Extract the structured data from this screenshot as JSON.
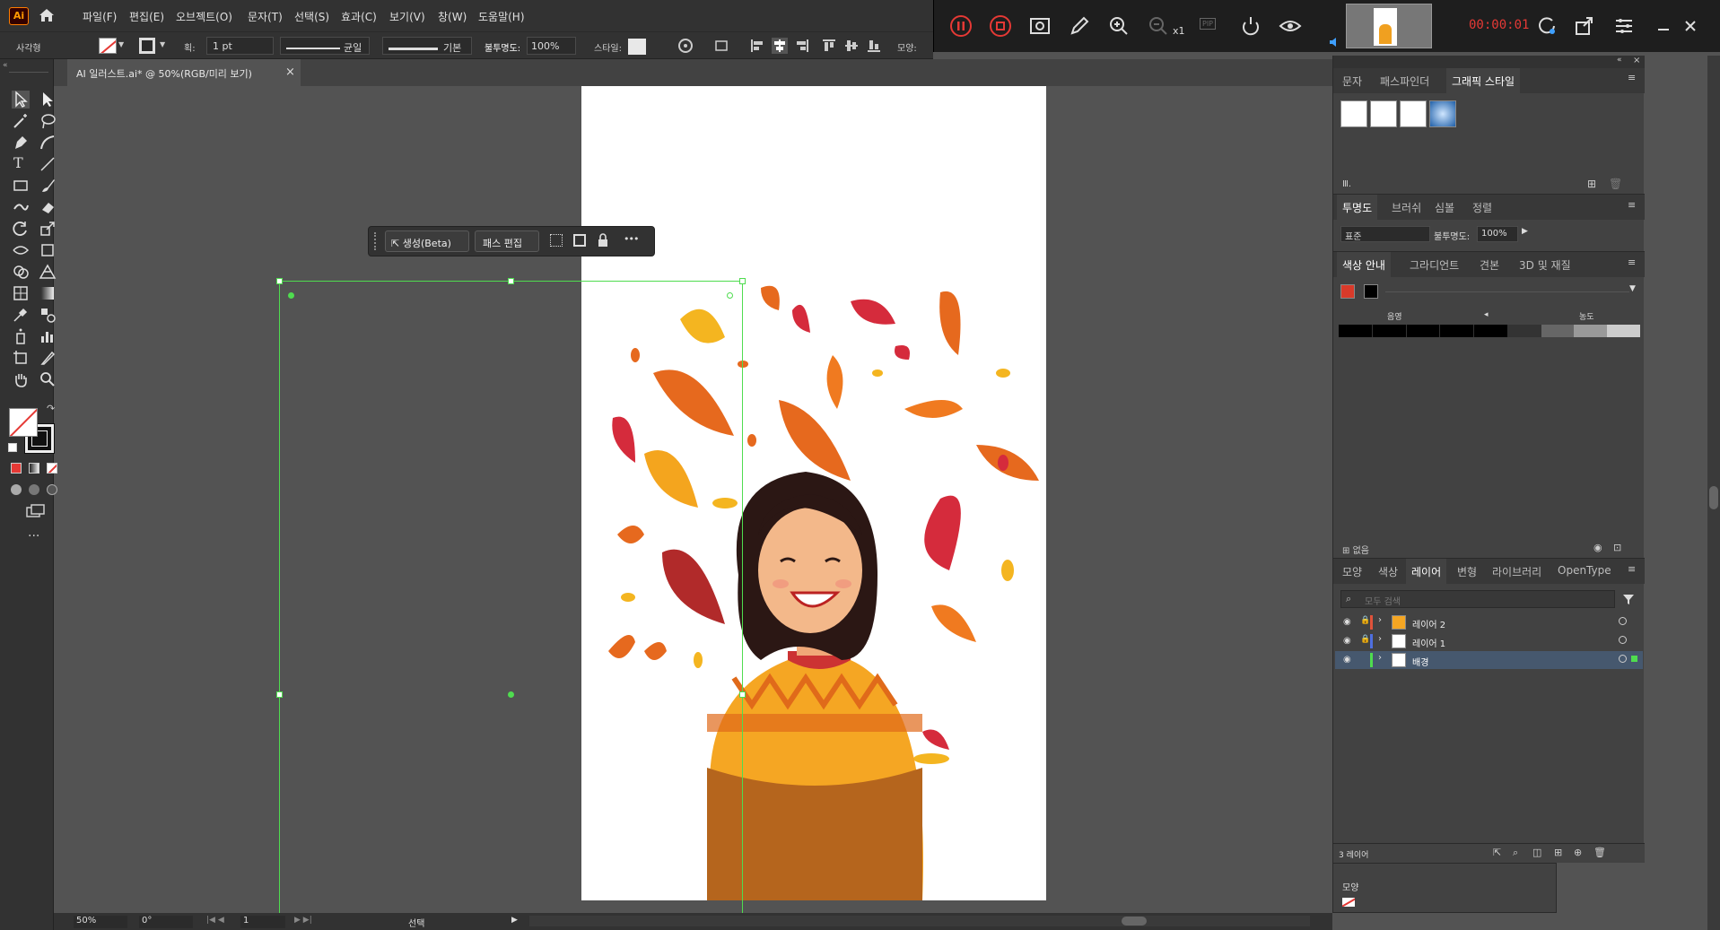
{
  "app": {
    "logo_text": "Ai"
  },
  "menu": [
    "파일(F)",
    "편집(E)",
    "오브젝트(O)",
    "문자(T)",
    "선택(S)",
    "효과(C)",
    "보기(V)",
    "창(W)",
    "도움말(H)"
  ],
  "recorder": {
    "time": "00:00:01",
    "zoom_label": "x1",
    "pip_label": "PIP"
  },
  "control": {
    "object_type": "사각형",
    "stroke_label": "획:",
    "stroke_value": "1 pt",
    "profile_uniform": "균일",
    "brush_basic": "기본",
    "opacity_label": "불투명도:",
    "opacity_value": "100%",
    "style_label": "스타일:",
    "shape_label": "모양:"
  },
  "document": {
    "tab_title": "AI 일러스트.ai* @ 50%(RGB/미리 보기)",
    "close": "×"
  },
  "taskbar": {
    "generate_label": "생성(Beta)",
    "edit_path_label": "패스 편집",
    "more": "•••"
  },
  "status": {
    "zoom": "50%",
    "rotation": "0°",
    "page": "1",
    "tool": "선택"
  },
  "panels": {
    "top_tabs": [
      "문자",
      "패스파인더",
      "그래픽 스타일"
    ],
    "transparency_tabs": [
      "투명도",
      "브러쉬",
      "심볼",
      "정렬"
    ],
    "blend_mode": "표준",
    "opacity_label": "불투명도:",
    "opacity_value": "100%",
    "color_guide_tabs": [
      "색상 안내",
      "그라디언트",
      "견본",
      "3D 및 재질"
    ],
    "shade_label": "음영",
    "tint_label": "농도",
    "none_label": "없음",
    "layer_tabs": [
      "모양",
      "색상",
      "레이어",
      "변형",
      "라이브러리",
      "OpenType"
    ],
    "layer_search_placeholder": "모두 검색",
    "layers": [
      {
        "name": "레이어 2",
        "color": "#e0523a"
      },
      {
        "name": "레이어 1",
        "color": "#4f6fe0"
      },
      {
        "name": "배경",
        "color": "#4fdc4f"
      }
    ],
    "layer_count": "3 레이어",
    "lower_panel_title": "모양"
  },
  "colors": {
    "accent_selection": "#4fdc4f",
    "ui_bg": "#535353",
    "panel_bg": "#424242"
  }
}
